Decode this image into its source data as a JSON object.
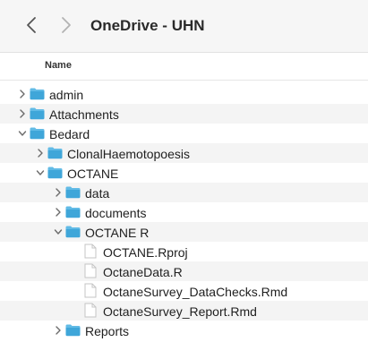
{
  "window": {
    "title": "OneDrive - UHN",
    "back_icon": "chevron-left-icon",
    "forward_icon": "chevron-right-icon"
  },
  "columns": {
    "name_header": "Name"
  },
  "colors": {
    "folder": "#3fa6d9",
    "folder_tab": "#62bbe6",
    "stripe": "#f4f4f4"
  },
  "items": [
    {
      "label": "admin",
      "type": "folder",
      "depth": 0,
      "expanded": false
    },
    {
      "label": "Attachments",
      "type": "folder",
      "depth": 0,
      "expanded": false
    },
    {
      "label": "Bedard",
      "type": "folder",
      "depth": 0,
      "expanded": true
    },
    {
      "label": "ClonalHaemotopoesis",
      "type": "folder",
      "depth": 1,
      "expanded": false
    },
    {
      "label": "OCTANE",
      "type": "folder",
      "depth": 1,
      "expanded": true
    },
    {
      "label": "data",
      "type": "folder",
      "depth": 2,
      "expanded": false
    },
    {
      "label": "documents",
      "type": "folder",
      "depth": 2,
      "expanded": false
    },
    {
      "label": "OCTANE R",
      "type": "folder",
      "depth": 2,
      "expanded": true
    },
    {
      "label": "OCTANE.Rproj",
      "type": "file",
      "depth": 3
    },
    {
      "label": "OctaneData.R",
      "type": "file",
      "depth": 3
    },
    {
      "label": "OctaneSurvey_DataChecks.Rmd",
      "type": "file",
      "depth": 3
    },
    {
      "label": "OctaneSurvey_Report.Rmd",
      "type": "file",
      "depth": 3
    },
    {
      "label": "Reports",
      "type": "folder",
      "depth": 2,
      "expanded": false
    }
  ]
}
